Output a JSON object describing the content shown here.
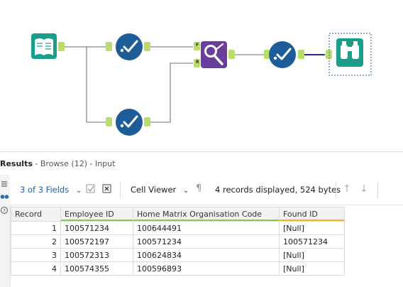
{
  "results": {
    "title": "Results",
    "subtitle": " - Browse (12) - Input"
  },
  "toolbar": {
    "fields_label": "3 of 3 Fields",
    "viewer_label": "Cell Viewer",
    "records_info": "4 records displayed, 524 bytes"
  },
  "tools": {
    "anchor_f": "F",
    "anchor_r": "R"
  },
  "table": {
    "headers": [
      "Record",
      "Employee ID",
      "Home Matrix Organisation Code",
      "Found ID"
    ],
    "rows": [
      {
        "record": "1",
        "employee_id": "100571234",
        "home_code": "100644491",
        "found_id": "[Null]"
      },
      {
        "record": "2",
        "employee_id": "100572197",
        "home_code": "100571234",
        "found_id": "100571234"
      },
      {
        "record": "3",
        "employee_id": "100572313",
        "home_code": "100624834",
        "found_id": "[Null]"
      },
      {
        "record": "4",
        "employee_id": "100574355",
        "home_code": "100596893",
        "found_id": "[Null]"
      }
    ]
  },
  "colors": {
    "input_tool": "#1a9e8c",
    "select_tool": "#1c5d99",
    "find_replace_tool": "#6a3f9a",
    "browse_tool": "#1a9e8c",
    "anchor": "#b9dd6a",
    "connector": "#8a8a8a",
    "active_connector": "#2e2a8a"
  }
}
